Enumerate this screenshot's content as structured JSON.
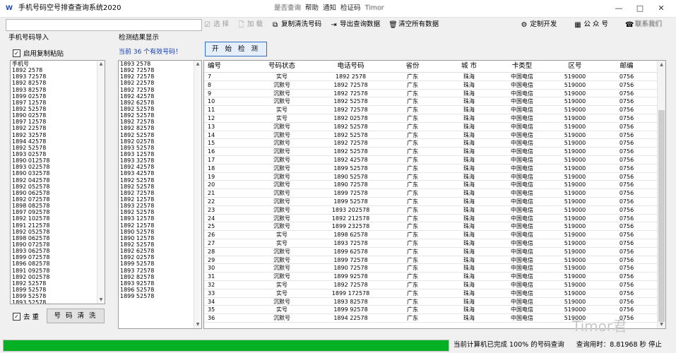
{
  "window": {
    "title": "手机号码空号排查查询系统2020",
    "menu": [
      "是否查询",
      "帮助",
      "通知",
      "检证码"
    ],
    "menu_blurred": "Timor",
    "controls": [
      "—",
      "□",
      "✕"
    ]
  },
  "toolbar": {
    "select_label": "选 择",
    "load_label": "加 载",
    "copy_clean_label": "复制清洗号码",
    "export_label": "导出查询数据",
    "clear_label": "清空所有数据",
    "custom_dev_label": "定制开发",
    "official_account_label": "公 众 号",
    "contact_label": "联系我们"
  },
  "left_panel": {
    "import_label": "手机号码导入",
    "enable_paste_label": "启用复制粘贴",
    "enable_paste_checked": true,
    "dedup_label": "去 重",
    "dedup_checked": true,
    "clean_button_label": "号 码 清 洗",
    "numbers": [
      "手机号",
      "1892 2578",
      "1893 72578",
      "1892 82578",
      "1893 82578",
      "1899 02578",
      "1897 12578",
      "1892 52578",
      "1890 02578",
      "1897 12578",
      "1892 22578",
      "1892 32578",
      "1894 42578",
      "1892 52578",
      "1893 02578",
      "1890 012578",
      "1893 022578",
      "1890 032578",
      "1892 042578",
      "1892 052578",
      "1890 062578",
      "1892 072578",
      "1898 082578",
      "1897 092578",
      "1892 102578",
      "1891 212578",
      "1892 052578",
      "1898 062578",
      "1890 072578",
      "1893 062578",
      "1899 072578",
      "1896 082578",
      "1891 092578",
      "1892 002578",
      "1892 52578",
      "1899 52578",
      "1899 52578",
      "1893 52578",
      "1894 52578"
    ]
  },
  "middle_panel": {
    "result_label": "检测结果显示",
    "count_text": "当前 36 个有效号码！",
    "numbers": [
      "1893 2578",
      "1892 72578",
      "1892 72578",
      "1892 22578",
      "1892 72578",
      "1892 42578",
      "1892 62578",
      "1892 52578",
      "1892 52578",
      "1892 72578",
      "1892 82578",
      "1892 52578",
      "1892 02578",
      "1893 52578",
      "1893 12578",
      "1893 32578",
      "1892 42578",
      "1893 42578",
      "1892 52578",
      "1892 52578",
      "1892 72578",
      "1892 12578",
      "1893 22578",
      "1892 52578",
      "1893 12578",
      "1892 12578",
      "1890 52578",
      "1890 12578",
      "1892 52578",
      "1892 62578",
      "1892 02578",
      "1899 52578",
      "1893 72578",
      "1892 82578",
      "1893 92578",
      "1896 52578",
      "1899 52578"
    ]
  },
  "grid": {
    "start_button_label": "开 始 检 测",
    "columns": [
      "编号",
      "号码状态",
      "电话号码",
      "省份",
      "城 市",
      "卡类型",
      "区号",
      "邮编"
    ],
    "rows": [
      [
        "7",
        "实号",
        "1892 2578",
        "广东",
        "珠海",
        "中国电信",
        "519000",
        "0756"
      ],
      [
        "8",
        "沉默号",
        "1892 72578",
        "广东",
        "珠海",
        "中国电信",
        "519000",
        "0756"
      ],
      [
        "9",
        "沉默号",
        "1892 72578",
        "广东",
        "珠海",
        "中国电信",
        "519000",
        "0756"
      ],
      [
        "10",
        "沉默号",
        "1892 52578",
        "广东",
        "珠海",
        "中国电信",
        "519000",
        "0756"
      ],
      [
        "11",
        "实号",
        "1892 72578",
        "广东",
        "珠海",
        "中国电信",
        "519000",
        "0756"
      ],
      [
        "12",
        "实号",
        "1892 02578",
        "广东",
        "珠海",
        "中国电信",
        "519000",
        "0756"
      ],
      [
        "13",
        "沉默号",
        "1892 52578",
        "广东",
        "珠海",
        "中国电信",
        "519000",
        "0756"
      ],
      [
        "14",
        "沉默号",
        "1892 52578",
        "广东",
        "珠海",
        "中国电信",
        "519000",
        "0756"
      ],
      [
        "15",
        "沉默号",
        "1892 72578",
        "广东",
        "珠海",
        "中国电信",
        "519000",
        "0756"
      ],
      [
        "16",
        "沉默号",
        "1892 52578",
        "广东",
        "珠海",
        "中国电信",
        "519000",
        "0756"
      ],
      [
        "17",
        "沉默号",
        "1892 42578",
        "广东",
        "珠海",
        "中国电信",
        "519000",
        "0756"
      ],
      [
        "18",
        "沉默号",
        "1899 52578",
        "广东",
        "珠海",
        "中国电信",
        "519000",
        "0756"
      ],
      [
        "19",
        "沉默号",
        "1890 52578",
        "广东",
        "珠海",
        "中国电信",
        "519000",
        "0756"
      ],
      [
        "20",
        "沉默号",
        "1890 72578",
        "广东",
        "珠海",
        "中国电信",
        "519000",
        "0756"
      ],
      [
        "21",
        "沉默号",
        "1899 72578",
        "广东",
        "珠海",
        "中国电信",
        "519000",
        "0756"
      ],
      [
        "22",
        "沉默号",
        "1899 52578",
        "广东",
        "珠海",
        "中国电信",
        "519000",
        "0756"
      ],
      [
        "23",
        "沉默号",
        "1893 202578",
        "广东",
        "珠海",
        "中国电信",
        "519000",
        "0756"
      ],
      [
        "24",
        "沉默号",
        "1892 212578",
        "广东",
        "珠海",
        "中国电信",
        "519000",
        "0756"
      ],
      [
        "25",
        "沉默号",
        "1899 232578",
        "广东",
        "珠海",
        "中国电信",
        "519000",
        "0756"
      ],
      [
        "26",
        "实号",
        "1898 62578",
        "广东",
        "珠海",
        "中国电信",
        "519000",
        "0756"
      ],
      [
        "27",
        "实号",
        "1893 72578",
        "广东",
        "珠海",
        "中国电信",
        "519000",
        "0756"
      ],
      [
        "28",
        "沉默号",
        "1899 62578",
        "广东",
        "珠海",
        "中国电信",
        "519000",
        "0756"
      ],
      [
        "29",
        "沉默号",
        "1899 72578",
        "广东",
        "珠海",
        "中国电信",
        "519000",
        "0756"
      ],
      [
        "30",
        "沉默号",
        "1890 72578",
        "广东",
        "珠海",
        "中国电信",
        "519000",
        "0756"
      ],
      [
        "31",
        "沉默号",
        "1899 92578",
        "广东",
        "珠海",
        "中国电信",
        "519000",
        "0756"
      ],
      [
        "32",
        "实号",
        "1892 72578",
        "广东",
        "珠海",
        "中国电信",
        "519000",
        "0756"
      ],
      [
        "33",
        "实号",
        "1899 172578",
        "广东",
        "珠海",
        "中国电信",
        "519000",
        "0756"
      ],
      [
        "34",
        "沉默号",
        "1893 82578",
        "广东",
        "珠海",
        "中国电信",
        "519000",
        "0756"
      ],
      [
        "35",
        "实号",
        "1899 92578",
        "广东",
        "珠海",
        "中国电信",
        "519000",
        "0756"
      ],
      [
        "36",
        "沉默号",
        "1894 22578",
        "广东",
        "珠海",
        "中国电信",
        "519000",
        "0756"
      ]
    ]
  },
  "status": {
    "progress_percent": 100,
    "progress_text": "当前计算机已完成 100% 的号码查询",
    "time_text": "查询用时：8.81968 秒 停止",
    "accent": "#06b025"
  },
  "watermark": "Timor君"
}
